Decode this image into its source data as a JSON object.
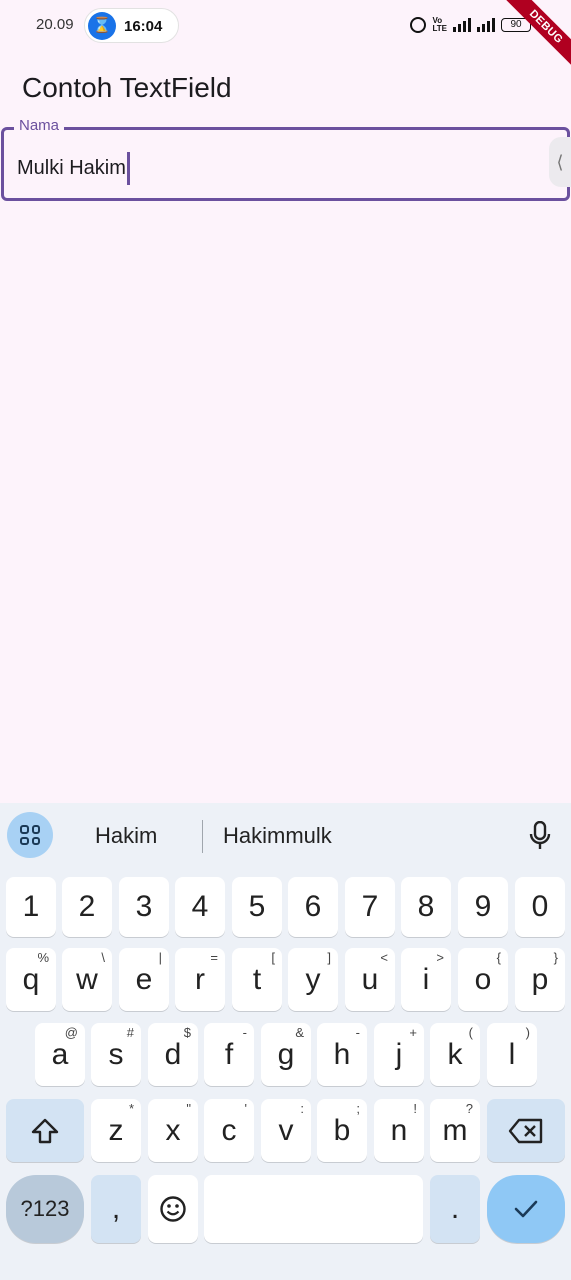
{
  "status_bar": {
    "left_time": "20.09",
    "pill_time": "16:04",
    "volte": "Vo\nLTE",
    "battery": "90"
  },
  "debug_banner": "DEBUG",
  "app_bar": {
    "title": "Contoh TextField"
  },
  "text_field": {
    "label": "Nama",
    "value": "Mulki Hakim"
  },
  "keyboard": {
    "suggestions": [
      "Hakim",
      "Hakimmulk"
    ],
    "number_row": [
      "1",
      "2",
      "3",
      "4",
      "5",
      "6",
      "7",
      "8",
      "9",
      "0"
    ],
    "row1": [
      {
        "key": "q",
        "hint": "%"
      },
      {
        "key": "w",
        "hint": "\\"
      },
      {
        "key": "e",
        "hint": "|"
      },
      {
        "key": "r",
        "hint": "="
      },
      {
        "key": "t",
        "hint": "["
      },
      {
        "key": "y",
        "hint": "]"
      },
      {
        "key": "u",
        "hint": "<"
      },
      {
        "key": "i",
        "hint": ">"
      },
      {
        "key": "o",
        "hint": "{"
      },
      {
        "key": "p",
        "hint": "}"
      }
    ],
    "row2": [
      {
        "key": "a",
        "hint": "@"
      },
      {
        "key": "s",
        "hint": "#"
      },
      {
        "key": "d",
        "hint": "$"
      },
      {
        "key": "f",
        "hint": "-"
      },
      {
        "key": "g",
        "hint": "&"
      },
      {
        "key": "h",
        "hint": "-"
      },
      {
        "key": "j",
        "hint": "+"
      },
      {
        "key": "k",
        "hint": "("
      },
      {
        "key": "l",
        "hint": ")"
      }
    ],
    "row3": [
      {
        "key": "z",
        "hint": "*"
      },
      {
        "key": "x",
        "hint": "\""
      },
      {
        "key": "c",
        "hint": "'"
      },
      {
        "key": "v",
        "hint": ":"
      },
      {
        "key": "b",
        "hint": ";"
      },
      {
        "key": "n",
        "hint": "!"
      },
      {
        "key": "m",
        "hint": "?"
      }
    ],
    "symbols_label": "?123",
    "comma": ",",
    "period": "."
  }
}
